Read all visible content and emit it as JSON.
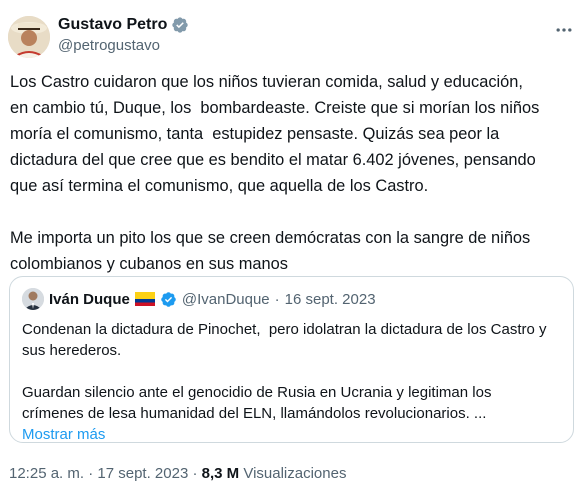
{
  "author": {
    "name": "Gustavo Petro",
    "handle": "@petrogustavo"
  },
  "tweet": {
    "text": "Los Castro cuidaron que los niños tuvieran comida, salud y educación,\nen cambio tú, Duque, los  bombardeaste. Creiste que si morían los niños\nmoría el comunismo, tanta  estupidez pensaste. Quizás sea peor la\ndictadura del que cree que es bendito el matar 6.402 jóvenes, pensando\nque así termina el comunismo, que aquella de los Castro.\n\nMe importa un pito los que se creen demócratas con la sangre de niños\ncolombianos y cubanos en sus manos"
  },
  "quoted": {
    "name": "Iván Duque",
    "handle": "@IvanDuque",
    "separator": "·",
    "date": "16 sept. 2023",
    "text": "Condenan la dictadura de Pinochet,  pero idolatran la dictadura de los Castro y\nsus herederos.\n\nGuardan silencio ante el genocidio de Rusia en Ucrania y legitiman los\ncrímenes de lesa humanidad del ELN, llamándolos revolucionarios. ...",
    "show_more": "Mostrar más"
  },
  "footer": {
    "time": "12:25 a. m.",
    "separator1": "·",
    "date": "17 sept. 2023",
    "separator2": "·",
    "views_count": "8,3 M",
    "views_label": "Visualizaciones"
  },
  "colors": {
    "verified": "#1d9bf0",
    "link": "#1d9bf0",
    "flag_yellow": "#fcd116",
    "flag_blue": "#003893",
    "flag_red": "#ce1126"
  },
  "icons": [
    "verified-badge-icon",
    "more-options-icon",
    "colombia-flag-icon"
  ]
}
